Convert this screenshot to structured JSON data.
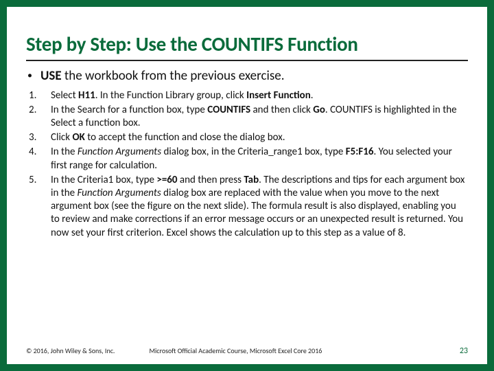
{
  "colors": {
    "accent": "#0a6b3b"
  },
  "title": "Step by Step: Use the COUNTIFS Function",
  "lead": {
    "bold": "USE",
    "rest": " the workbook from the previous exercise."
  },
  "steps": [
    {
      "num": "1.",
      "parts": [
        {
          "t": "Select "
        },
        {
          "t": "H11",
          "b": true
        },
        {
          "t": ". In the Function Library group, click "
        },
        {
          "t": "Insert Function",
          "b": true
        },
        {
          "t": "."
        }
      ]
    },
    {
      "num": "2.",
      "parts": [
        {
          "t": "In the Search for a function box, type "
        },
        {
          "t": "COUNTIFS",
          "b": true
        },
        {
          "t": " and then click "
        },
        {
          "t": "Go",
          "b": true
        },
        {
          "t": ". COUNTIFS is highlighted in the Select a function box."
        }
      ]
    },
    {
      "num": "3.",
      "parts": [
        {
          "t": "Click "
        },
        {
          "t": "OK",
          "b": true
        },
        {
          "t": " to accept the function and close the dialog box."
        }
      ]
    },
    {
      "num": "4.",
      "parts": [
        {
          "t": "In the "
        },
        {
          "t": "Function Arguments",
          "i": true
        },
        {
          "t": " dialog box, in the Criteria_range1 box, type "
        },
        {
          "t": "F5:F16",
          "b": true
        },
        {
          "t": ". You selected your first range for calculation."
        }
      ]
    },
    {
      "num": "5.",
      "parts": [
        {
          "t": "In the Criteria1 box, type "
        },
        {
          "t": ">=60",
          "b": true
        },
        {
          "t": " and then press "
        },
        {
          "t": "Tab",
          "b": true
        },
        {
          "t": ". The descriptions and tips for each argument box in the "
        },
        {
          "t": "Function Arguments",
          "i": true
        },
        {
          "t": " dialog box are replaced with the value when you move to the next argument box (see the figure on the next slide). The formula result is also displayed, enabling you to review and make corrections if an error message occurs or an unexpected result is returned. You now set your first criterion. Excel shows the calculation up to this step as a value of 8."
        }
      ]
    }
  ],
  "footer": {
    "copyright": "© 2016, John Wiley & Sons, Inc.",
    "course": "Microsoft Official Academic Course, Microsoft Excel Core 2016",
    "page": "23"
  }
}
